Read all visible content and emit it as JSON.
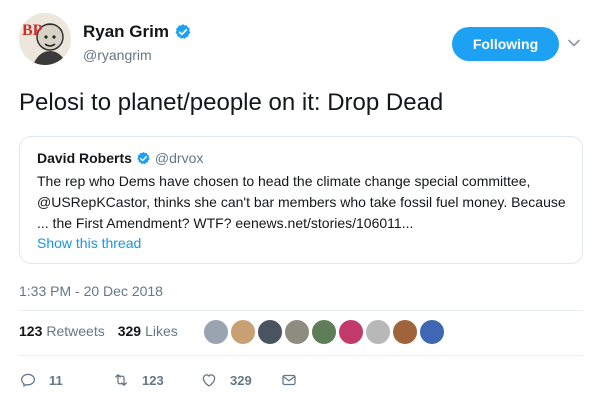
{
  "author": {
    "display_name": "Ryan Grim",
    "handle": "@ryangrim",
    "avatar_letters": "BP"
  },
  "follow_button": {
    "label": "Following"
  },
  "tweet_text": "Pelosi to planet/people on it: Drop Dead",
  "quoted_tweet": {
    "display_name": "David Roberts",
    "handle": "@drvox",
    "text_lines": [
      "The rep who Dems have chosen to head the climate change special committee,",
      "@USRepKCastor, thinks she can't bar members who take fossil fuel money. Because",
      "... the First Amendment? WTF? eenews.net/stories/106011..."
    ],
    "show_thread": "Show this thread"
  },
  "timestamp": "1:33 PM - 20 Dec 2018",
  "stats": {
    "retweets_count": "123",
    "retweets_label": "Retweets",
    "likes_count": "329",
    "likes_label": "Likes"
  },
  "liker_avatars": [
    {
      "color": "#9aa5b1"
    },
    {
      "color": "#c9a073"
    },
    {
      "color": "#4a5360"
    },
    {
      "color": "#8c8c80"
    },
    {
      "color": "#5f7d58"
    },
    {
      "color": "#c23a6a"
    },
    {
      "color": "#b8b8b8"
    },
    {
      "color": "#a0643c"
    },
    {
      "color": "#3f67b3"
    }
  ],
  "actions": {
    "reply_count": "11",
    "retweet_count": "123",
    "like_count": "329"
  },
  "icons": {
    "verified": "verified-badge-icon",
    "caret": "chevron-down-icon",
    "reply": "reply-icon",
    "retweet": "retweet-icon",
    "like": "heart-icon",
    "message": "envelope-icon"
  },
  "colors": {
    "accent": "#1da1f2",
    "link": "#1b95e0",
    "secondary_text": "#657786",
    "border": "#e1e8ed"
  }
}
